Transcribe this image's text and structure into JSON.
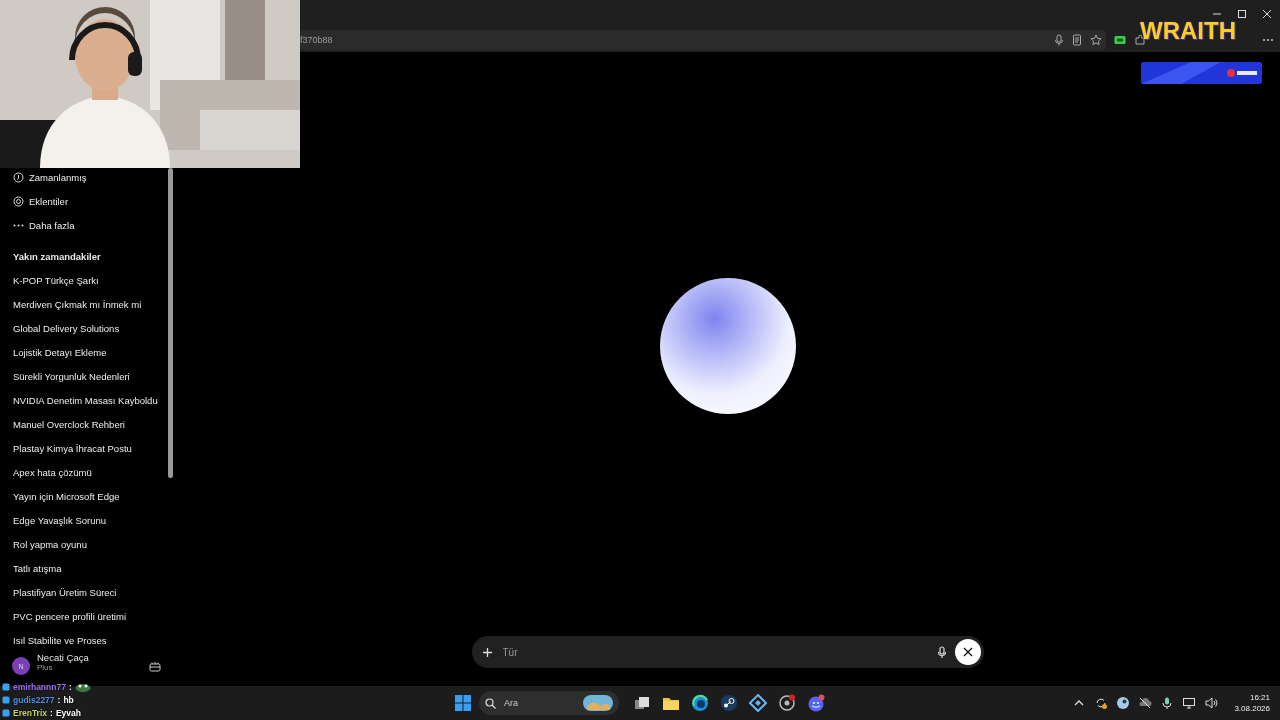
{
  "browser": {
    "address": "f370b88"
  },
  "sidebar": {
    "menu": [
      {
        "label": "Zamanlanmış",
        "kind": "clock"
      },
      {
        "label": "Eklentiler",
        "kind": "at"
      },
      {
        "label": "Daha fazla",
        "kind": "more"
      }
    ],
    "recent_heading": "Yakın zamandakiler",
    "recents": [
      "K-POP Türkçe Şarkı",
      "Merdiven Çıkmak mı İnmek mi",
      "Global Delivery Solutions",
      "Lojistik Detayı Ekleme",
      "Sürekli Yorgunluk Nedenleri",
      "NVIDIA Denetim Masası Kayboldu",
      "Manuel Overclock Rehberi",
      "Plastay Kimya İhracat Postu",
      "Apex hata çözümü",
      "Yayın için Microsoft Edge",
      "Edge Yavaşlık Sorunu",
      "Rol yapma oyunu",
      "Tatlı atışma",
      "Plastifiyan Üretim Süreci",
      "PVC pencere profili üretimi",
      "Isıl Stabilite ve Proses"
    ],
    "user": {
      "initial": "N",
      "name": "Necati Çaça",
      "plan": "Plus"
    }
  },
  "composer": {
    "placeholder": "Tür"
  },
  "taskbar": {
    "search_placeholder": "Ara",
    "time": "16:21",
    "date": "3.08.2026"
  },
  "overlay": {
    "logo": "WRAITH",
    "chat": [
      {
        "user": "emirhannn77",
        "separator": ":",
        "color": "#9a6cf0",
        "kind": "emote"
      },
      {
        "user": "gudis2277",
        "separator": ":",
        "color": "#4f8fe8",
        "kind": "text",
        "text": "hb"
      },
      {
        "user": "ErenTrix",
        "separator": ":",
        "color": "#c9d45a",
        "kind": "text",
        "text": "Eyvah"
      }
    ]
  }
}
